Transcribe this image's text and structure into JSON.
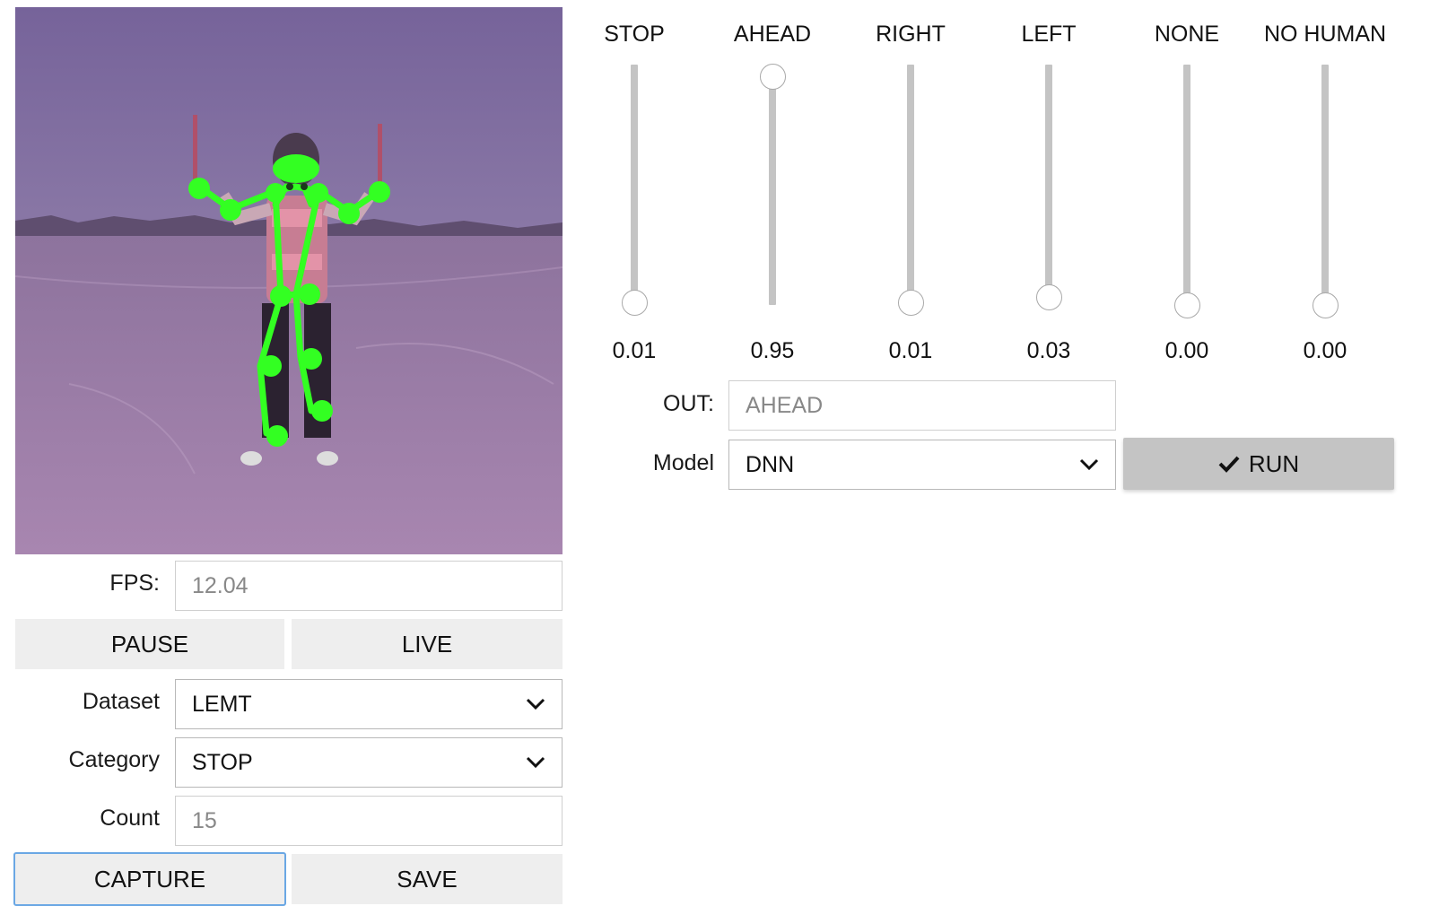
{
  "camera": {
    "feed_description_icon": "camera-feed-image"
  },
  "fps": {
    "label": "FPS:",
    "value": "12.04"
  },
  "buttons": {
    "pause": "PAUSE",
    "live": "LIVE",
    "capture": "CAPTURE",
    "save": "SAVE",
    "run": "RUN",
    "run_icon": "check-icon"
  },
  "dataset": {
    "label": "Dataset",
    "selected": "LEMT"
  },
  "category": {
    "label": "Category",
    "selected": "STOP"
  },
  "count": {
    "label": "Count",
    "value": "15"
  },
  "sliders": [
    {
      "name": "STOP",
      "value_text": "0.01",
      "value": 0.01
    },
    {
      "name": "AHEAD",
      "value_text": "0.95",
      "value": 0.95
    },
    {
      "name": "RIGHT",
      "value_text": "0.01",
      "value": 0.01
    },
    {
      "name": "LEFT",
      "value_text": "0.03",
      "value": 0.03
    },
    {
      "name": "NONE",
      "value_text": "0.00",
      "value": 0.0
    },
    {
      "name": "NO HUMAN",
      "value_text": "0.00",
      "value": 0.0
    }
  ],
  "out": {
    "label": "OUT:",
    "value": "AHEAD"
  },
  "model": {
    "label": "Model",
    "selected": "DNN"
  },
  "colors": {
    "skeleton": "#33ff22",
    "track": "#c4c4c4",
    "focus_border": "#6aa7e4"
  }
}
